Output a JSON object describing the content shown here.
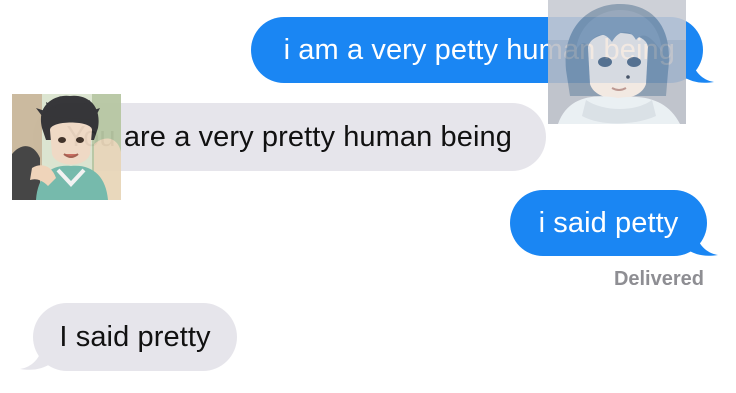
{
  "conversation": {
    "messages": [
      {
        "text": "i am a very petty human being",
        "direction": "outgoing"
      },
      {
        "text": "You are a very pretty human being",
        "direction": "incoming"
      },
      {
        "text": "i said petty",
        "direction": "outgoing"
      },
      {
        "text": "I said pretty",
        "direction": "incoming"
      }
    ],
    "status": "Delivered"
  },
  "colors": {
    "outgoing_bubble": "#1a86f3",
    "incoming_bubble": "#e6e5eb",
    "status_text": "#8e8e93"
  },
  "icons": {
    "avatar_right": "anime-character-portrait-avatar",
    "avatar_left": "anime-character-group-avatar"
  }
}
